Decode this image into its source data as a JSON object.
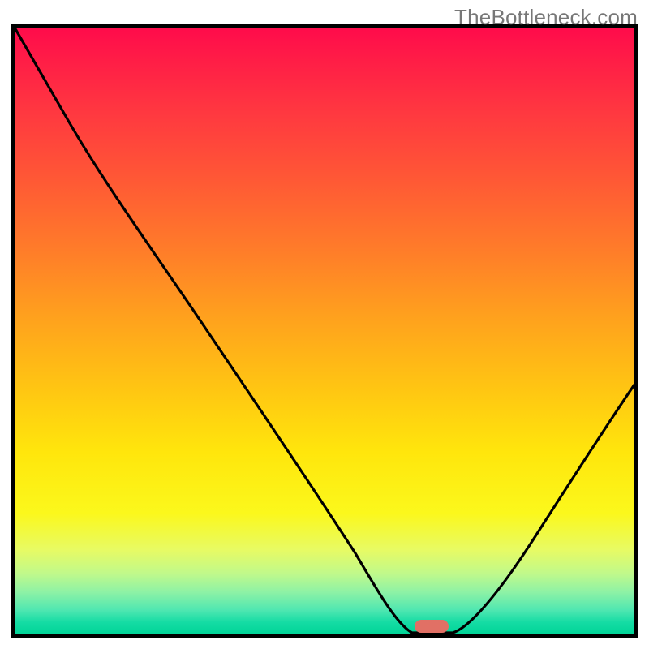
{
  "watermark": "TheBottleneck.com",
  "colors": {
    "gradient_top": "#ff0b4b",
    "gradient_bottom": "#00d497",
    "curve_stroke": "#000000",
    "marker_fill": "#e17065",
    "border": "#000000"
  },
  "chart_data": {
    "type": "line",
    "title": "",
    "xlabel": "",
    "ylabel": "",
    "xlim": [
      0,
      100
    ],
    "ylim": [
      0,
      100
    ],
    "series": [
      {
        "name": "bottleneck-curve",
        "x": [
          0,
          10,
          20,
          30,
          40,
          50,
          58,
          63,
          68,
          72,
          80,
          90,
          100
        ],
        "y": [
          100,
          84,
          70,
          55,
          40,
          25,
          10,
          3,
          0,
          0,
          10,
          22,
          35
        ]
      }
    ],
    "annotations": [
      {
        "name": "optimal-marker",
        "x": 70,
        "y": 0,
        "shape": "pill"
      }
    ],
    "grid": false,
    "legend": false
  }
}
